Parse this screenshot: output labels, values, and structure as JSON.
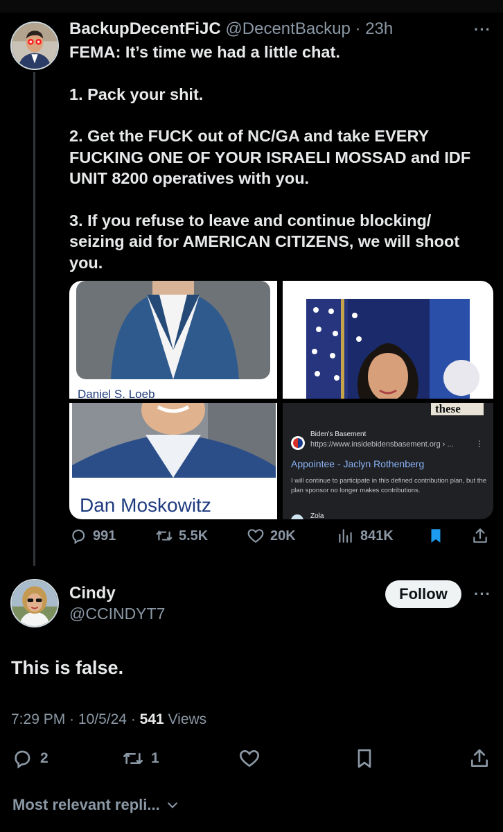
{
  "colors": {
    "background": "#000000",
    "text": "#e7e9ea",
    "muted": "#8b98a5",
    "bookmark_active": "#1d9bf0"
  },
  "tweet1": {
    "display_name": "BackupDecentFiJC",
    "handle": "@DecentBackup",
    "time": "· 23h",
    "more_icon": "more-dots-icon",
    "paragraphs": [
      "FEMA: It’s time we had a little chat.",
      "1. Pack your shit.",
      "2. Get the FUCK out of NC/GA and take EVERY FUCKING ONE OF YOUR ISRAELI MOSSAD and IDF UNIT 8200 operatives with you.",
      "3. If you refuse to leave and continue blocking/ seizing aid for AMERICAN CITIZENS, we will shoot you."
    ],
    "media": {
      "image1_caption": "Daniel S. Loeb",
      "image3_caption": "Dan Moskowitz",
      "search_result": {
        "site_name": "Biden's Basement",
        "url": "https://www.insidebidensbasement.org › ...",
        "title": "Appointee - Jaclyn Rothenberg",
        "snippet": "I will continue to participate in this defined contribution plan, but the plan sponsor no longer makes contributions.",
        "next_site": "Zola"
      }
    },
    "actions": {
      "replies": "991",
      "reposts": "5.5K",
      "likes": "20K",
      "views": "841K"
    }
  },
  "tweet2": {
    "display_name": "Cindy",
    "handle": "@CCINDYT7",
    "follow_label": "Follow",
    "text": "This is false.",
    "time": "7:29 PM",
    "date": "10/5/24",
    "views_count": "541",
    "views_label": "Views",
    "actions": {
      "replies": "2",
      "reposts": "1"
    }
  },
  "replies_sort_label": "Most relevant repli..."
}
